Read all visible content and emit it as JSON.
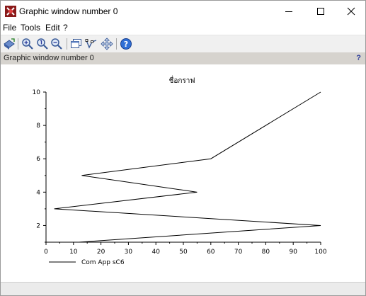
{
  "window": {
    "title": "Graphic window number 0"
  },
  "menu": {
    "file": "File",
    "tools": "Tools",
    "edit": "Edit",
    "help": "?"
  },
  "toolbar": {
    "icons": [
      "rotate-3d-icon",
      "zoom-in-icon",
      "zoom-reset-icon",
      "zoom-out-icon",
      "datatip-window-icon",
      "datatip-edit-icon",
      "pan-icon",
      "help-icon"
    ]
  },
  "infobar": {
    "text": "Graphic window number 0",
    "help": "?"
  },
  "colors": {
    "infobar": "#d6d3ce",
    "toolbar": "#f0f0f0",
    "help_icon": "#2f6fd6",
    "plot_line": "#000000"
  },
  "chart_data": {
    "type": "line",
    "title": "ชื่อกราฟ",
    "xlabel": "",
    "ylabel": "",
    "xlim": [
      0,
      100
    ],
    "ylim": [
      1,
      10
    ],
    "x_ticks": [
      "0",
      "10",
      "20",
      "30",
      "40",
      "50",
      "60",
      "70",
      "80",
      "90",
      "100"
    ],
    "y_ticks": [
      "2",
      "4",
      "6",
      "8",
      "10"
    ],
    "grid": false,
    "legend_position": "bottom-left",
    "series": [
      {
        "name": "Com App sC6",
        "x": [
          12,
          100,
          3,
          55,
          13,
          60,
          100
        ],
        "y": [
          1,
          2,
          3,
          4,
          5,
          6,
          10
        ]
      }
    ]
  }
}
